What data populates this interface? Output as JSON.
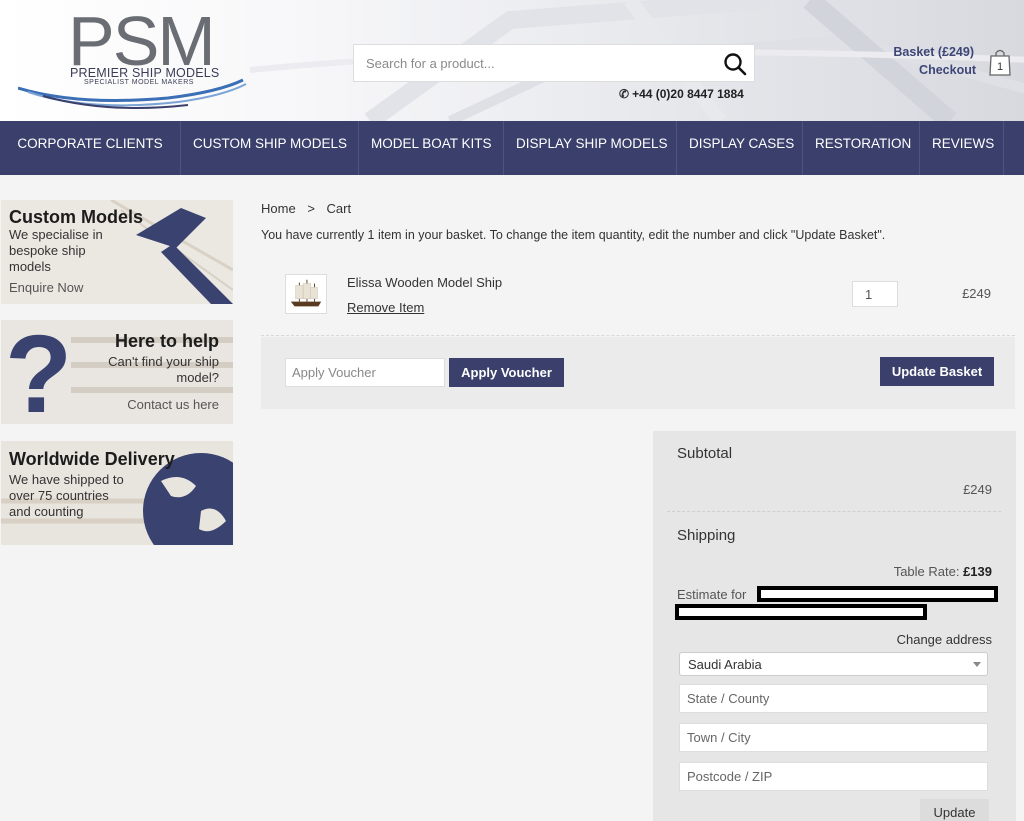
{
  "header": {
    "logo": {
      "main": "PSM",
      "name": "PREMIER SHIP MODELS",
      "sub": "SPECIALIST MODEL MAKERS"
    },
    "search": {
      "placeholder": "Search for a product..."
    },
    "phone": "+44 (0)20 8447 1884",
    "basket_label": "Basket (£249)",
    "checkout_label": "Checkout",
    "basket_count": "1"
  },
  "nav": {
    "items": [
      {
        "label": "CORPORATE CLIENTS"
      },
      {
        "label": "CUSTOM SHIP MODELS"
      },
      {
        "label": "MODEL BOAT KITS"
      },
      {
        "label": "DISPLAY SHIP MODELS"
      },
      {
        "label": "DISPLAY CASES"
      },
      {
        "label": "RESTORATION"
      },
      {
        "label": "REVIEWS"
      }
    ]
  },
  "sidebar": {
    "custom": {
      "title": "Custom Models",
      "line1": "We specialise in",
      "line2": "bespoke ship",
      "line3": "models",
      "link": "Enquire Now"
    },
    "help": {
      "title": "Here to help",
      "line1": "Can't find your ship",
      "line2": "model?",
      "link": "Contact us here"
    },
    "delivery": {
      "title": "Worldwide Delivery",
      "line1": "We have shipped to",
      "line2": "over 75 countries",
      "line3": "and counting"
    }
  },
  "cart": {
    "breadcrumb": {
      "home": "Home",
      "sep": ">",
      "current": "Cart"
    },
    "intro": "You have currently 1 item in your basket. To change the item quantity, edit the number and click \"Update Basket\".",
    "item": {
      "name": "Elissa Wooden Model Ship",
      "remove": "Remove Item",
      "qty": "1",
      "price": "£249"
    },
    "voucher_placeholder": "Apply Voucher",
    "apply_voucher": "Apply Voucher",
    "update_basket": "Update Basket"
  },
  "totals": {
    "subtotal_label": "Subtotal",
    "subtotal_value": "£249",
    "shipping_label": "Shipping",
    "rate_label": "Table Rate:",
    "rate_value": "£139",
    "estimate_label": "Estimate for",
    "change_address": "Change address",
    "country": "Saudi Arabia",
    "state_placeholder": "State / County",
    "town_placeholder": "Town / City",
    "postcode_placeholder": "Postcode / ZIP",
    "update": "Update"
  },
  "colors": {
    "brand": "#3a3f6b",
    "nav_text": "#ffffff"
  }
}
